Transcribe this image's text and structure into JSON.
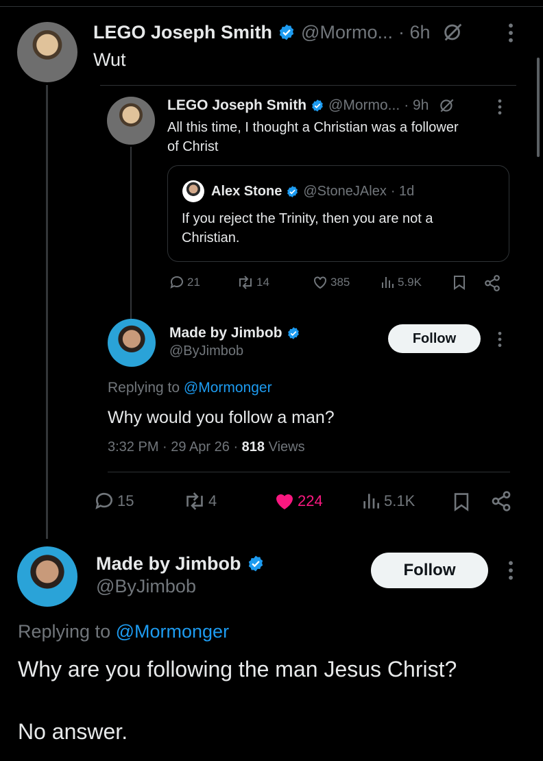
{
  "post1": {
    "author": "LEGO Joseph Smith",
    "handle": "@Mormo...",
    "time": "· 6h",
    "text": "Wut"
  },
  "quoted1": {
    "author": "LEGO Joseph Smith",
    "handle": "@Mormo...",
    "time": "· 9h",
    "text_line1": "All this time, I thought a Christian was a follower",
    "text_line2": "of Christ",
    "stats": {
      "replies": "21",
      "reposts": "14",
      "likes": "385",
      "views": "5.9K"
    }
  },
  "quoted2": {
    "author": "Alex Stone",
    "handle": "@StoneJAlex",
    "time": "· 1d",
    "text_line1": "If you reject the Trinity, then you are not a",
    "text_line2": "Christian."
  },
  "inner_reply": {
    "author": "Made by Jimbob",
    "handle": "@ByJimbob",
    "follow": "Follow",
    "replying_prefix": "Replying to",
    "replying_to": "@Mormonger",
    "text": "Why would you follow a man?",
    "meta_time": "3:32 PM · 29 Apr 26 ·",
    "views_count": "818",
    "views_label": "Views"
  },
  "post1_stats": {
    "replies": "15",
    "reposts": "4",
    "likes": "224",
    "views": "5.1K"
  },
  "main_reply": {
    "author": "Made by Jimbob",
    "handle": "@ByJimbob",
    "follow": "Follow",
    "replying_prefix": "Replying to",
    "replying_to": "@Mormonger",
    "text_line1": "Why are you following the man Jesus Christ?",
    "text_line2": "No answer."
  },
  "colors": {
    "accent": "#1d9bf0",
    "like": "#f91880",
    "muted": "#71767b"
  },
  "icons": [
    "verified-icon",
    "grok-icon",
    "more-icon",
    "reply-icon",
    "repost-icon",
    "like-icon",
    "views-icon",
    "bookmark-icon",
    "share-icon"
  ]
}
